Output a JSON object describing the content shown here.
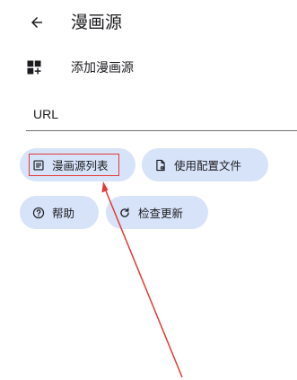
{
  "app_bar": {
    "title": "漫画源"
  },
  "add_source": {
    "label": "添加漫画源"
  },
  "url_field": {
    "placeholder": "URL"
  },
  "actions": {
    "list_label": "漫画源列表",
    "config_label": "使用配置文件",
    "help_label": "帮助",
    "update_label": "检查更新"
  },
  "icons": {
    "back": "arrow-left-icon",
    "add": "dashboard-add-icon",
    "list": "article-icon",
    "config": "file-gear-icon",
    "help": "help-circle-icon",
    "update": "refresh-icon"
  },
  "colors": {
    "chip_background": "#d7e3f8",
    "annotation": "#e53935"
  }
}
